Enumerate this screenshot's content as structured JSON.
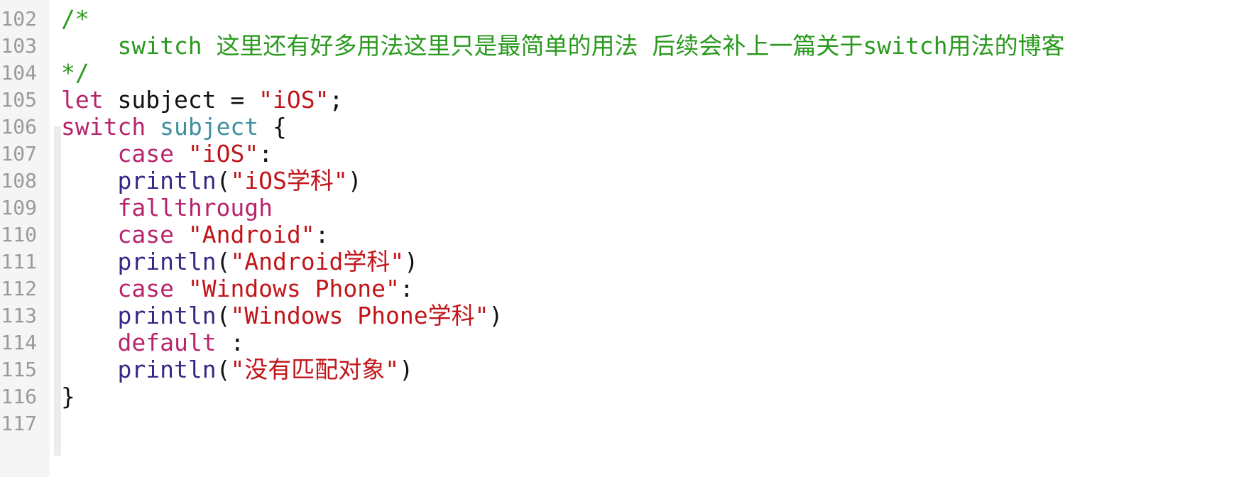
{
  "editor": {
    "lines": [
      {
        "number": "102",
        "tokens": [
          {
            "text": "/*",
            "style": "cmt"
          }
        ]
      },
      {
        "number": "103",
        "tokens": [
          {
            "text": "    switch 这里还有好多用法这里只是最简单的用法 后续会补上一篇关于switch用法的博客",
            "style": "cmt"
          }
        ]
      },
      {
        "number": "104",
        "tokens": [
          {
            "text": "*/",
            "style": "cmt"
          }
        ]
      },
      {
        "number": "105",
        "tokens": [
          {
            "text": "let",
            "style": "kw"
          },
          {
            "text": " subject = ",
            "style": "plain"
          },
          {
            "text": "\"iOS\"",
            "style": "str"
          },
          {
            "text": ";",
            "style": "plain"
          }
        ]
      },
      {
        "number": "106",
        "tokens": [
          {
            "text": "switch",
            "style": "kw"
          },
          {
            "text": " ",
            "style": "plain"
          },
          {
            "text": "subject",
            "style": "ident"
          },
          {
            "text": " {",
            "style": "plain"
          }
        ]
      },
      {
        "number": "107",
        "tokens": [
          {
            "text": "    ",
            "style": "plain"
          },
          {
            "text": "case",
            "style": "kw"
          },
          {
            "text": " ",
            "style": "plain"
          },
          {
            "text": "\"iOS\"",
            "style": "str"
          },
          {
            "text": ":",
            "style": "plain"
          }
        ]
      },
      {
        "number": "108",
        "tokens": [
          {
            "text": "    ",
            "style": "plain"
          },
          {
            "text": "println",
            "style": "call"
          },
          {
            "text": "(",
            "style": "plain"
          },
          {
            "text": "\"iOS学科\"",
            "style": "str"
          },
          {
            "text": ")",
            "style": "plain"
          }
        ]
      },
      {
        "number": "109",
        "tokens": [
          {
            "text": "    ",
            "style": "plain"
          },
          {
            "text": "fallthrough",
            "style": "kw"
          }
        ]
      },
      {
        "number": "110",
        "tokens": [
          {
            "text": "    ",
            "style": "plain"
          },
          {
            "text": "case",
            "style": "kw"
          },
          {
            "text": " ",
            "style": "plain"
          },
          {
            "text": "\"Android\"",
            "style": "str"
          },
          {
            "text": ":",
            "style": "plain"
          }
        ]
      },
      {
        "number": "111",
        "tokens": [
          {
            "text": "    ",
            "style": "plain"
          },
          {
            "text": "println",
            "style": "call"
          },
          {
            "text": "(",
            "style": "plain"
          },
          {
            "text": "\"Android学科\"",
            "style": "str"
          },
          {
            "text": ")",
            "style": "plain"
          }
        ]
      },
      {
        "number": "112",
        "tokens": [
          {
            "text": "    ",
            "style": "plain"
          },
          {
            "text": "case",
            "style": "kw"
          },
          {
            "text": " ",
            "style": "plain"
          },
          {
            "text": "\"Windows Phone\"",
            "style": "str"
          },
          {
            "text": ":",
            "style": "plain"
          }
        ]
      },
      {
        "number": "113",
        "tokens": [
          {
            "text": "    ",
            "style": "plain"
          },
          {
            "text": "println",
            "style": "call"
          },
          {
            "text": "(",
            "style": "plain"
          },
          {
            "text": "\"Windows Phone学科\"",
            "style": "str"
          },
          {
            "text": ")",
            "style": "plain"
          }
        ]
      },
      {
        "number": "114",
        "tokens": [
          {
            "text": "    ",
            "style": "plain"
          },
          {
            "text": "default",
            "style": "kw"
          },
          {
            "text": " :",
            "style": "plain"
          }
        ]
      },
      {
        "number": "115",
        "tokens": [
          {
            "text": "    ",
            "style": "plain"
          },
          {
            "text": "println",
            "style": "call"
          },
          {
            "text": "(",
            "style": "plain"
          },
          {
            "text": "\"没有匹配对象\"",
            "style": "str"
          },
          {
            "text": ")",
            "style": "plain"
          }
        ]
      },
      {
        "number": "116",
        "tokens": [
          {
            "text": "}",
            "style": "plain"
          }
        ]
      },
      {
        "number": "117",
        "tokens": []
      }
    ]
  },
  "colors": {
    "keyword": "#b8246c",
    "string": "#c1151a",
    "comment": "#2a9a1e",
    "plain": "#111111",
    "identifier": "#3f8f9f",
    "function_call": "#3a2684",
    "line_number": "#9a9a9a",
    "gutter_bg": "#f5f5f5"
  }
}
